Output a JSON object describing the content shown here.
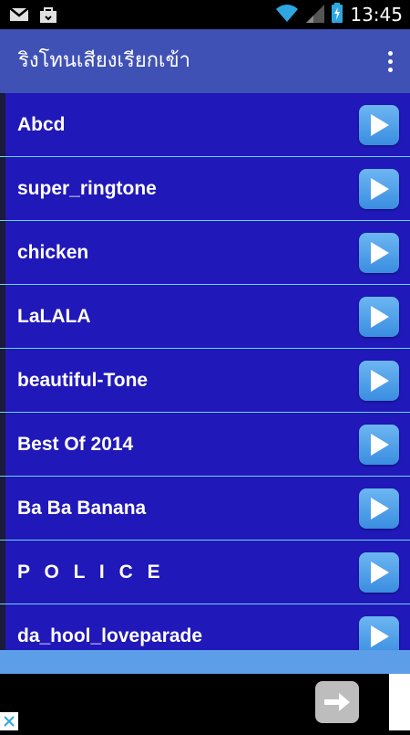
{
  "status_bar": {
    "time": "13:45"
  },
  "app_bar": {
    "title": "ริงโทนเสียงเรียกเข้า"
  },
  "ringtones": [
    {
      "label": "Abcd"
    },
    {
      "label": "super_ringtone"
    },
    {
      "label": "chicken"
    },
    {
      "label": "LaLALA"
    },
    {
      "label": "beautiful-Tone"
    },
    {
      "label": "Best Of 2014"
    },
    {
      "label": "Ba Ba Banana"
    },
    {
      "label": "P O L I C E"
    },
    {
      "label": "da_hool_loveparade"
    }
  ],
  "colors": {
    "app_bar": "#3f51b5",
    "list_bg": "#2018b8",
    "divider": "#6fd3f0",
    "play_button": "#4a9ee8"
  }
}
